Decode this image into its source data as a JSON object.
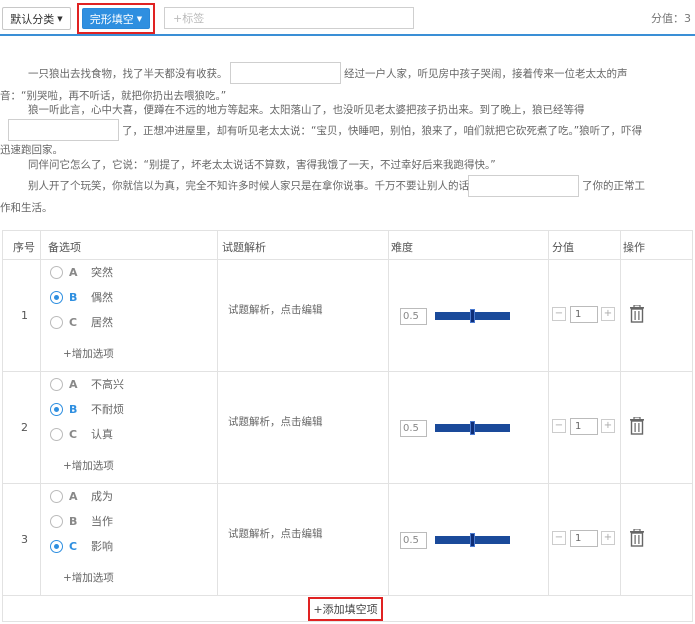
{
  "toolbar": {
    "category_label": "默认分类",
    "type_label": "完形填空",
    "tag_placeholder": "+标签",
    "score_total": "分值：3"
  },
  "passage": {
    "line1": "一只狼出去找食物，找了半天都没有收获。",
    "line1b": "经过一户人家，听见房中孩子哭闹，接着传来一位老太太的声",
    "line2": "音：“别哭啦，再不听话，就把你扔出去喂狼吃。”",
    "line3": "狼一听此言，心中大喜，便蹲在不远的地方等起来。太阳落山了，也没听见老太婆把孩子扔出来。到了晚上，狼已经等得",
    "line4b": "了，正想冲进屋里，却有听见老太太说：“宝贝，快睡吧，别怕，狼来了，咱们就把它砍死煮了吃。”狼听了，吓得",
    "line5": "迅速跑回家。",
    "line6": "同伴问它怎么了，它说：“别提了，坏老太太说话不算数，害得我饿了一天，不过幸好后来我跑得快。”",
    "line7": "别人开了个玩笑，你就信以为真，完全不知许多时候人家只是在拿你说事。千万不要让别人的话",
    "line7b": "了你的正常工",
    "line8": "作和生活。"
  },
  "table": {
    "headers": {
      "num": "序号",
      "options": "备选项",
      "analysis": "试题解析",
      "difficulty": "难度",
      "score": "分值",
      "action": "操作"
    },
    "rows": [
      {
        "num": "1",
        "options": [
          {
            "letter": "A",
            "text": "突然"
          },
          {
            "letter": "B",
            "text": "偶然"
          },
          {
            "letter": "C",
            "text": "居然"
          }
        ],
        "selected": "B",
        "add_option": "+增加选项",
        "analysis": "试题解析，点击编辑",
        "difficulty": "0.5",
        "score": "1",
        "slider_level": 0.5
      },
      {
        "num": "2",
        "options": [
          {
            "letter": "A",
            "text": "不高兴"
          },
          {
            "letter": "B",
            "text": "不耐烦"
          },
          {
            "letter": "C",
            "text": "认真"
          }
        ],
        "selected": "B",
        "add_option": "+增加选项",
        "analysis": "试题解析，点击编辑",
        "difficulty": "0.5",
        "score": "1",
        "slider_level": 0.5
      },
      {
        "num": "3",
        "options": [
          {
            "letter": "A",
            "text": "成为"
          },
          {
            "letter": "B",
            "text": "当作"
          },
          {
            "letter": "C",
            "text": "影响"
          }
        ],
        "selected": "C",
        "add_option": "+增加选项",
        "analysis": "试题解析，点击编辑",
        "difficulty": "0.5",
        "score": "1",
        "slider_level": 0.5
      }
    ],
    "stepper_minus": "−",
    "stepper_plus": "+"
  },
  "add_blank_label": "+添加填空项",
  "colors": {
    "accent": "#2f8fe0",
    "highlight_frame": "#e02222",
    "slider": "#1a4a9a"
  }
}
